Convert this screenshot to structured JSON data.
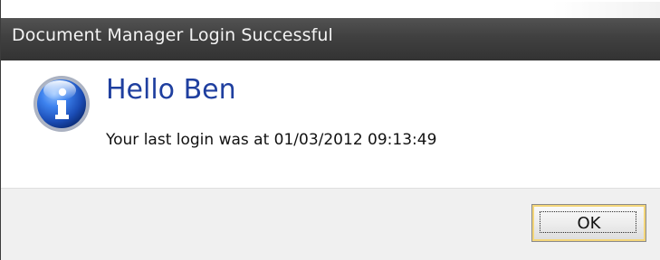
{
  "window": {
    "title": "Document Manager Login Successful"
  },
  "dialog": {
    "icon": "info-icon",
    "heading": "Hello Ben",
    "message": "Your last login was at 01/03/2012 09:13:49",
    "ok_label": "OK"
  },
  "colors": {
    "title_bar": "#3f3f3f",
    "heading": "#1f3f9f",
    "footer": "#f0f0f0",
    "button_focus": "#f4d67a"
  }
}
